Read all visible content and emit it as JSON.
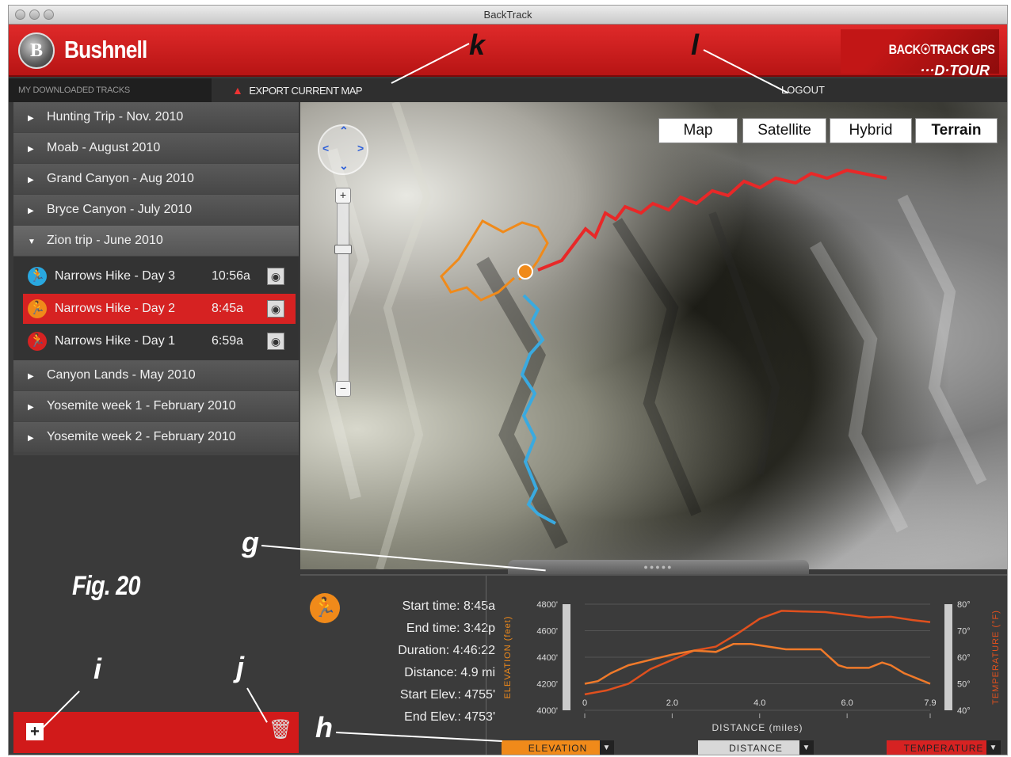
{
  "window": {
    "title": "BackTrack"
  },
  "header": {
    "logo_letter": "B",
    "brand": "Bushnell",
    "product_line1": "BACK☉TRACK GPS",
    "product_line2": "···D·TOUR",
    "accent_color": "#d11a1a"
  },
  "nav": {
    "tracks_label": "MY DOWNLOADED TRACKS",
    "export_label": "EXPORT CURRENT MAP",
    "logout_label": "LOGOUT"
  },
  "tracks": [
    {
      "label": "Hunting Trip - Nov. 2010"
    },
    {
      "label": "Moab - August 2010"
    },
    {
      "label": "Grand Canyon - Aug 2010"
    },
    {
      "label": "Bryce Canyon - July 2010"
    },
    {
      "label": "Zion trip - June 2010"
    },
    {
      "label": "Canyon Lands - May 2010"
    },
    {
      "label": "Yosemite week 1 - February 2010"
    },
    {
      "label": "Yosemite week 2 - February 2010"
    }
  ],
  "subtracks": [
    {
      "name": "Narrows Hike - Day 3",
      "time": "10:56a",
      "color": "#29a8e0"
    },
    {
      "name": "Narrows Hike - Day 2",
      "time": "8:45a",
      "color": "#f08a1a"
    },
    {
      "name": "Narrows Hike - Day 1",
      "time": "6:59a",
      "color": "#d62222"
    }
  ],
  "map_types": [
    "Map",
    "Satellite",
    "Hybrid",
    "Terrain"
  ],
  "selected_map_type": "Terrain",
  "stats": {
    "start_time": "Start time: 8:45a",
    "end_time": "End time: 3:42p",
    "duration": "Duration: 4:46:22",
    "distance": "Distance: 4.9 mi",
    "start_elev": "Start Elev.: 4755'",
    "end_elev": "End Elev.: 4753'"
  },
  "chart": {
    "left_axis_label": "ELEVATION (feet)",
    "right_axis_label": "TEMPERATURE (°F)",
    "x_axis_label": "DISTANCE (miles)",
    "left_ticks": [
      "4800'",
      "4600'",
      "4400'",
      "4200'",
      "4000'"
    ],
    "right_ticks": [
      "80°",
      "70°",
      "60°",
      "50°",
      "40°"
    ],
    "x_ticks": [
      "0",
      "2.0",
      "4.0",
      "6.0",
      "7.9"
    ]
  },
  "dropdowns": {
    "elevation": "ELEVATION",
    "distance": "DISTANCE",
    "temperature": "TEMPERATURE"
  },
  "figure_label": "Fig. 20",
  "callouts": {
    "g": "g",
    "h": "h",
    "i": "i",
    "j": "j",
    "k": "k",
    "l": "l"
  },
  "chart_data": {
    "type": "line",
    "x_label": "DISTANCE (miles)",
    "x_ticks": [
      0,
      2.0,
      4.0,
      6.0,
      7.9
    ],
    "xlim": [
      0,
      7.9
    ],
    "y_left_label": "ELEVATION (feet)",
    "y_left_lim": [
      4000,
      4800
    ],
    "y_right_label": "TEMPERATURE (°F)",
    "y_right_lim": [
      40,
      80
    ],
    "grid": true,
    "series": [
      {
        "axis": "left",
        "color": "#e0501e",
        "x": [
          0,
          0.5,
          1.0,
          1.5,
          2.0,
          2.5,
          3.0,
          3.5,
          4.0,
          4.5,
          5.0,
          5.5,
          6.0,
          6.5,
          7.0,
          7.5,
          7.9
        ],
        "y": [
          4120,
          4150,
          4200,
          4310,
          4380,
          4450,
          4480,
          4580,
          4690,
          4750,
          4745,
          4740,
          4720,
          4700,
          4705,
          4680,
          4665
        ]
      },
      {
        "axis": "right",
        "color": "#f07a2a",
        "x": [
          0,
          0.3,
          0.6,
          1.0,
          1.5,
          2.0,
          2.5,
          3.0,
          3.4,
          3.8,
          4.2,
          4.6,
          5.0,
          5.4,
          5.8,
          6.0,
          6.5,
          6.8,
          7.0,
          7.3,
          7.6,
          7.9
        ],
        "y": [
          50,
          51,
          54,
          57,
          59,
          61,
          62.5,
          62,
          65,
          65,
          64,
          63,
          63,
          63,
          57,
          56,
          56,
          58,
          57,
          54,
          52,
          50
        ]
      }
    ]
  }
}
